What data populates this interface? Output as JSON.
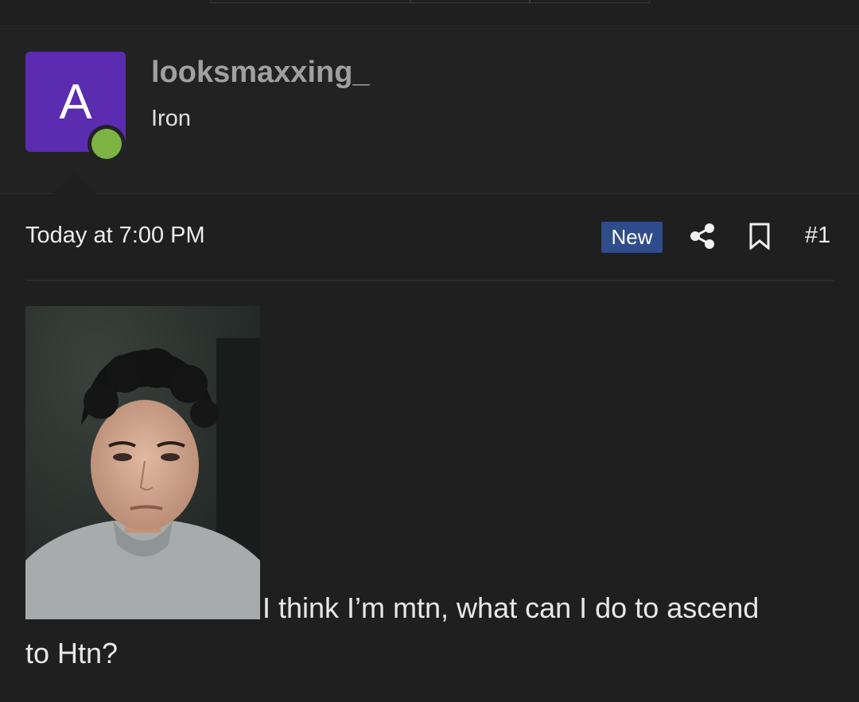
{
  "user": {
    "avatar_letter": "A",
    "username": "looksmaxxing_",
    "title": "Iron",
    "avatar_color": "#5b2bb0",
    "online_color": "#7cb342"
  },
  "post": {
    "date": "Today at 7:00 PM",
    "badge": "New",
    "number": "#1",
    "text_line1": "I think I’m mtn, what can I do to ascend",
    "text_line2": "to Htn?",
    "image_icon": "selfie-photo",
    "share_icon": "share-icon",
    "bookmark_icon": "bookmark-icon"
  },
  "colors": {
    "background": "#1f1f1f",
    "header_background": "#222222",
    "badge_background": "#2f4d8a"
  }
}
